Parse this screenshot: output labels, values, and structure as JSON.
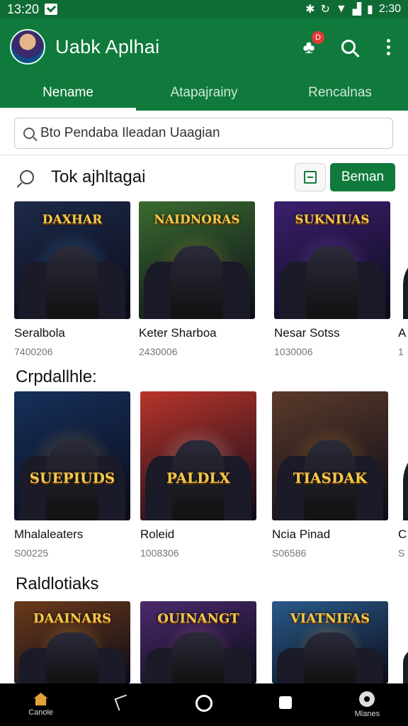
{
  "status_bar": {
    "time": "13:20",
    "battery_time": "2:30"
  },
  "app_bar": {
    "title": "Uabk Aplhai",
    "notification_count": "D"
  },
  "tabs": [
    {
      "label": "Nename",
      "active": true
    },
    {
      "label": "Atapajrainy",
      "active": false
    },
    {
      "label": "Rencalnas",
      "active": false
    }
  ],
  "search": {
    "value": "Bto Pendaba Ileadan Uaagian"
  },
  "top_row": {
    "title": "Tok ajhltagai",
    "primary_button": "Beman"
  },
  "featured": [
    {
      "name": "Seralbola",
      "sub": "7400206",
      "logo": "DAXHAR",
      "bg": "#1d2a4a",
      "accent": "#3fa9f5"
    },
    {
      "name": "Keter Sharboa",
      "sub": "2430006",
      "logo": "NAIDNORAS",
      "bg": "#3a6b2f",
      "accent": "#e0a838"
    },
    {
      "name": "Nesar Sotss",
      "sub": "1030006",
      "logo": "SUKNIUAS",
      "bg": "#3b1f6e",
      "accent": "#a76cf0"
    },
    {
      "name": "A",
      "sub": "1",
      "logo": "",
      "bg": "#d6a720",
      "accent": "#222"
    }
  ],
  "sections": [
    {
      "title": "Crpdallhle:",
      "items": [
        {
          "name": "Mhalaleaters",
          "sub": "S00225",
          "logo": "SUEPIUDS",
          "bg": "#16305a",
          "accent": "#f0b030"
        },
        {
          "name": "Roleid",
          "sub": "1008306",
          "logo": "PALDLX",
          "bg": "#b8342b",
          "accent": "#ffffff"
        },
        {
          "name": "Ncia Pinad",
          "sub": "S06586",
          "logo": "TIASDAK",
          "bg": "#5a3a2a",
          "accent": "#f0a030"
        },
        {
          "name": "C",
          "sub": "S",
          "logo": "",
          "bg": "#2a2a3a",
          "accent": "#ccc"
        }
      ]
    },
    {
      "title": "Raldlotiaks",
      "items": [
        {
          "name": "",
          "sub": "",
          "logo": "DAAINARS",
          "bg": "#6b3a1a",
          "accent": "#f0b030"
        },
        {
          "name": "",
          "sub": "",
          "logo": "OUINANGT",
          "bg": "#4a2a6b",
          "accent": "#e060c0"
        },
        {
          "name": "",
          "sub": "",
          "logo": "VIATNIFAS",
          "bg": "#2a5a8a",
          "accent": "#f0b030"
        },
        {
          "name": "",
          "sub": "",
          "logo": "",
          "bg": "#d6a720",
          "accent": "#222"
        }
      ]
    }
  ],
  "bottom_nav": [
    {
      "label": "Canole",
      "icon": "home-icon"
    },
    {
      "label": "",
      "icon": "back-icon"
    },
    {
      "label": "",
      "icon": "circle-icon"
    },
    {
      "label": "",
      "icon": "square-icon"
    },
    {
      "label": "Mlanes",
      "icon": "gear-icon"
    }
  ]
}
